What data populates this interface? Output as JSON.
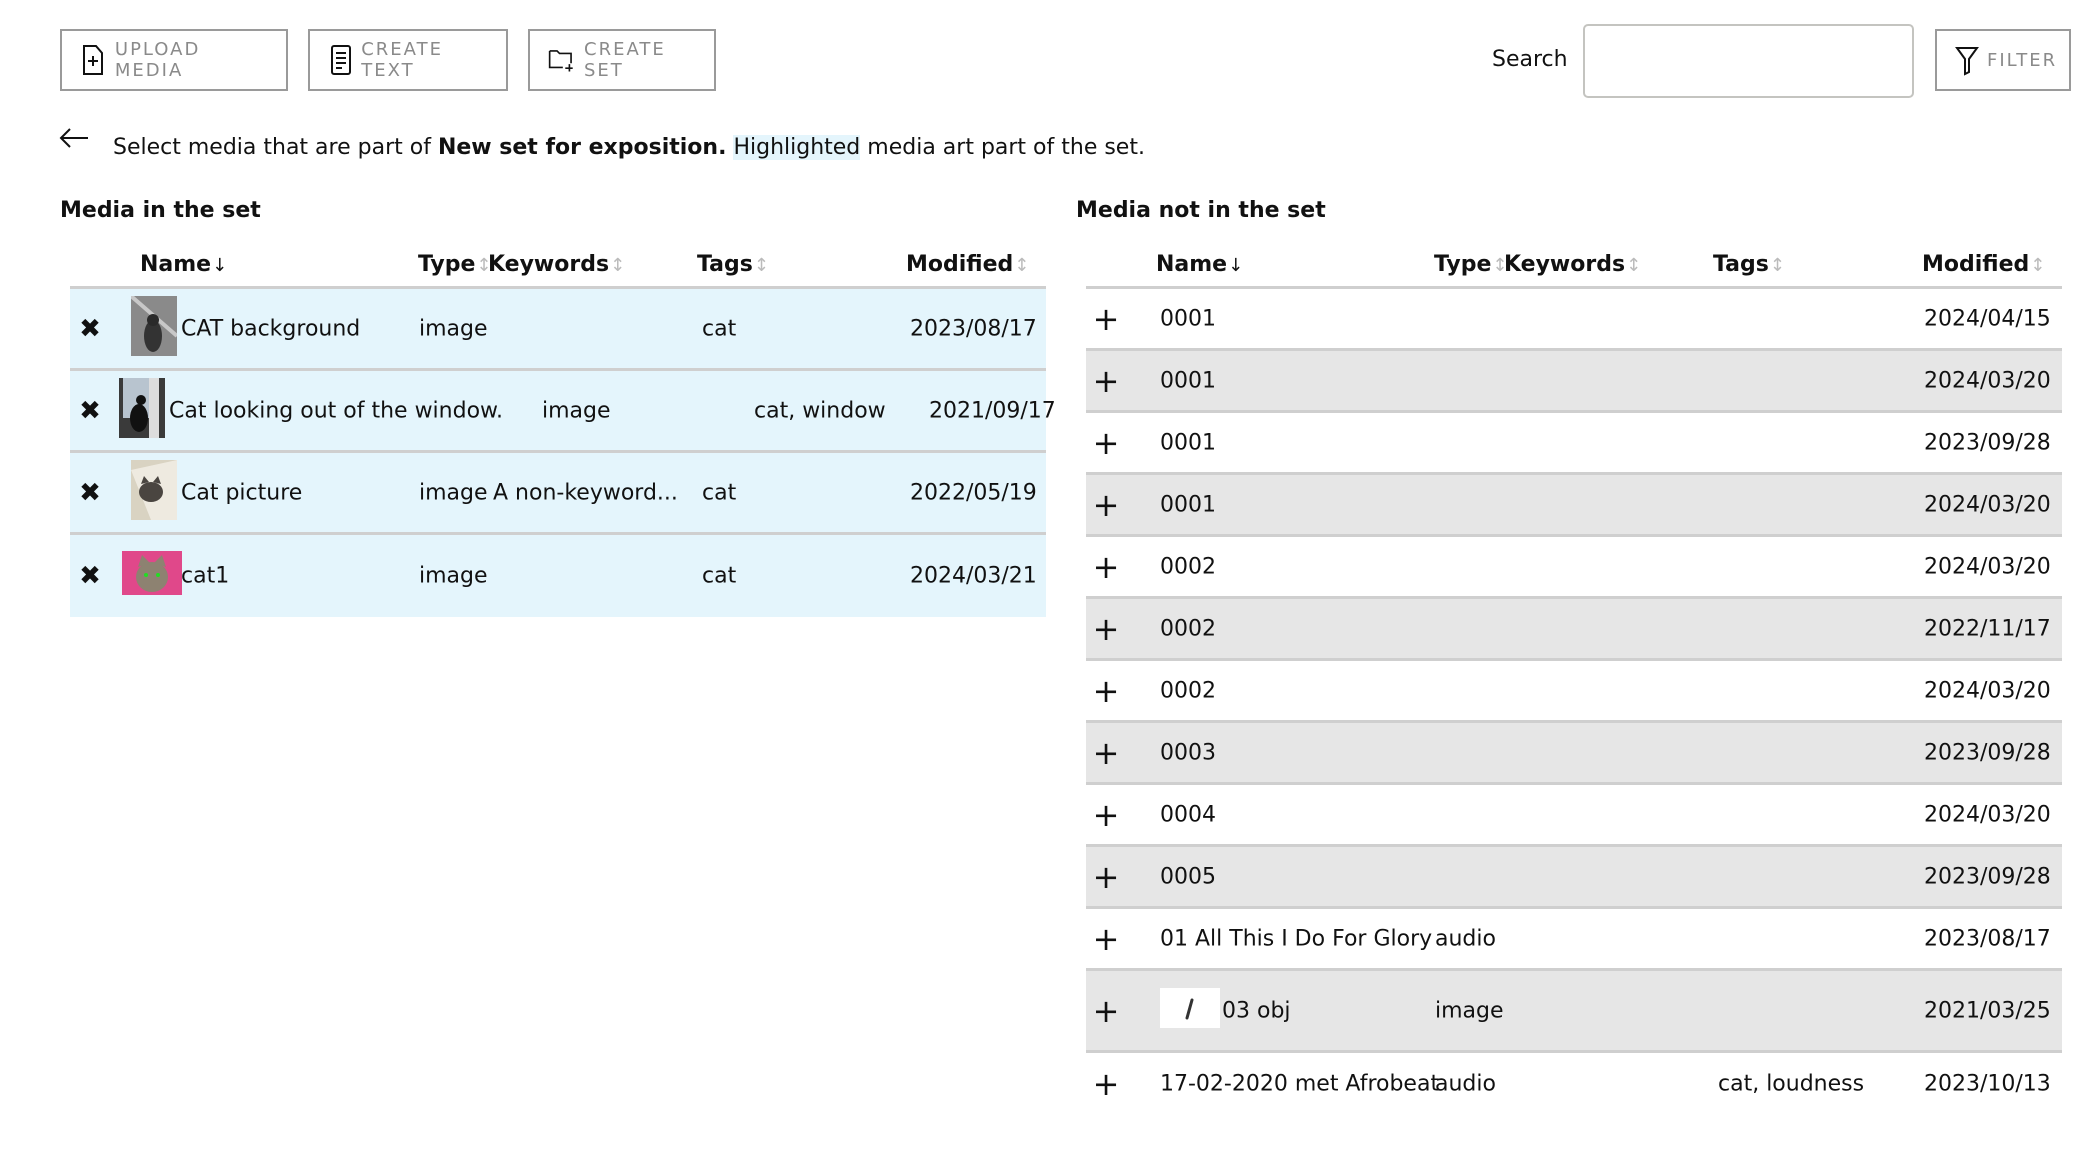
{
  "toolbar": {
    "upload_label": "UPLOAD MEDIA",
    "create_text_label": "CREATE TEXT",
    "create_set_label": "CREATE SET",
    "search_label": "Search",
    "search_value": "",
    "search_placeholder": "",
    "filter_label": "FILTER"
  },
  "instruction": {
    "back_icon": "arrow-left-icon",
    "prefix": "Select media that are part of ",
    "set_name": "New set for exposition.",
    "highlight_word": "Highlighted",
    "suffix": " media art part of the set."
  },
  "in_set": {
    "title": "Media in the set",
    "columns": {
      "name": "Name",
      "type": "Type",
      "keywords": "Keywords",
      "tags": "Tags",
      "modified": "Modified"
    },
    "sort_active": "↓",
    "sort_idle": "↕",
    "remove_icon": "✖",
    "highlight_color": "#e4f5fc",
    "rows": [
      {
        "name": "CAT background",
        "type": "image",
        "keywords": "",
        "tags": "cat",
        "modified": "2023/08/17",
        "thumb": "gray-cat-photo"
      },
      {
        "name": "Cat looking out of the window.",
        "type": "image",
        "keywords": "",
        "tags": "cat, window",
        "modified": "2021/09/17",
        "thumb": "window-cat-photo"
      },
      {
        "name": "Cat picture",
        "type": "image",
        "keywords": "A non-keyword...",
        "tags": "cat",
        "modified": "2022/05/19",
        "thumb": "cat-picture-photo"
      },
      {
        "name": "cat1",
        "type": "image",
        "keywords": "",
        "tags": "cat",
        "modified": "2024/03/21",
        "thumb": "tabby-cat-photo"
      }
    ]
  },
  "not_in_set": {
    "title": "Media not in the set",
    "columns": {
      "name": "Name",
      "type": "Type",
      "keywords": "Keywords",
      "tags": "Tags",
      "modified": "Modified"
    },
    "add_icon": "+",
    "rows": [
      {
        "name": "0001",
        "type": "",
        "keywords": "",
        "tags": "",
        "modified": "2024/04/15"
      },
      {
        "name": "0001",
        "type": "",
        "keywords": "",
        "tags": "",
        "modified": "2024/03/20"
      },
      {
        "name": "0001",
        "type": "",
        "keywords": "",
        "tags": "",
        "modified": "2023/09/28"
      },
      {
        "name": "0001",
        "type": "",
        "keywords": "",
        "tags": "",
        "modified": "2024/03/20"
      },
      {
        "name": "0002",
        "type": "",
        "keywords": "",
        "tags": "",
        "modified": "2024/03/20"
      },
      {
        "name": "0002",
        "type": "",
        "keywords": "",
        "tags": "",
        "modified": "2022/11/17"
      },
      {
        "name": "0002",
        "type": "",
        "keywords": "",
        "tags": "",
        "modified": "2024/03/20"
      },
      {
        "name": "0003",
        "type": "",
        "keywords": "",
        "tags": "",
        "modified": "2023/09/28"
      },
      {
        "name": "0004",
        "type": "",
        "keywords": "",
        "tags": "",
        "modified": "2024/03/20"
      },
      {
        "name": "0005",
        "type": "",
        "keywords": "",
        "tags": "",
        "modified": "2023/09/28"
      },
      {
        "name": "01 All This I Do For Glory",
        "type": "audio",
        "keywords": "",
        "tags": "",
        "modified": "2023/08/17"
      },
      {
        "name": "03 obj",
        "type": "image",
        "keywords": "",
        "tags": "",
        "modified": "2021/03/25",
        "thumb": "pen-stroke-image"
      },
      {
        "name": "17-02-2020 met Afrobeat",
        "type": "audio",
        "keywords": "",
        "tags": "cat, loudness",
        "modified": "2023/10/13"
      }
    ]
  }
}
